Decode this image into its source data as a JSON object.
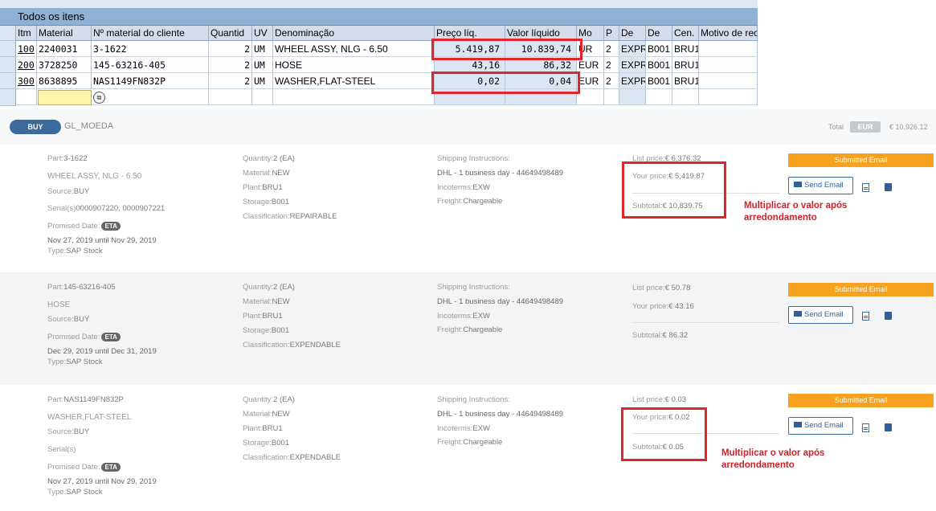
{
  "sap": {
    "title": "Todos os itens",
    "columns": [
      "Itm",
      "Material",
      "Nº material do cliente",
      "Quantid",
      "UV",
      "Denominação",
      "Preço líq.",
      "Valor líquido",
      "Mo",
      "P",
      "De",
      "De",
      "Cen.",
      "Motivo de rec"
    ],
    "rows": [
      {
        "itm": "100",
        "material": "2240031",
        "cust": "3-1622",
        "qty": "2",
        "uv": "UM",
        "desc": "WHEEL ASSY, NLG - 6.50",
        "price": "5.419,87",
        "value": "10.839,74",
        "mo": "UR",
        "p": "2",
        "de1": "EXPR",
        "de2": "B001",
        "cen": "BRU1"
      },
      {
        "itm": "200",
        "material": "3728250",
        "cust": "145-63216-405",
        "qty": "2",
        "uv": "UM",
        "desc": "HOSE",
        "price": "43,16",
        "value": "86,32",
        "mo": "EUR",
        "p": "2",
        "de1": "EXPR",
        "de2": "B001",
        "cen": "BRU1"
      },
      {
        "itm": "300",
        "material": "8638895",
        "cust": "NAS1149FN832P",
        "qty": "2",
        "uv": "UM",
        "desc": "WASHER,FLAT-STEEL",
        "price": "0,02",
        "value": "0,04",
        "mo": "EUR",
        "p": "2",
        "de1": "EXPR",
        "de2": "B001",
        "cen": "BRU1"
      }
    ],
    "highlight_color": "#e0262c"
  },
  "header": {
    "buy_label": "BUY",
    "currency_field": "GL_MOEDA",
    "total_label": "Total",
    "currency": "EUR",
    "total_value": "€ 10,926.12"
  },
  "items": [
    {
      "part_label": "Part:",
      "part": "3-1622",
      "name": "WHEEL ASSY, NLG - 6.50",
      "source_label": "Source:",
      "source": "BUY",
      "serials_label": "Serial(s)",
      "serials": "0000907220, 0000907221",
      "promised_label": "Promised Date:",
      "eta": "ETA",
      "dates": "Nov 27, 2019 until Nov 29, 2019",
      "type_label": "Type:",
      "type": "SAP Stock",
      "qty_label": "Quantity:",
      "qty": "2 (EA)",
      "material_label": "Material:",
      "material": "NEW",
      "plant_label": "Plant:",
      "plant": "BRU1",
      "storage_label": "Storage:",
      "storage": "B001",
      "class_label": "Classification:",
      "classification": "REPAIRABLE",
      "ship_label": "Shipping Instructions:",
      "ship": "DHL - 1 business day - 44649498489",
      "inco_label": "Incoterms:",
      "inco": "EXW",
      "freight_label": "Freight:",
      "freight": "Chargeable",
      "list_label": "List price:",
      "list": "€ 6,376.32",
      "your_label": "Your price:",
      "your": "€ 5,419.87",
      "sub_label": "Subtotal:",
      "subtotal": "€ 10,839.75",
      "status": "Submitted Email",
      "send": "Send Email",
      "annotation": "Multiplicar o valor após arredondamento"
    },
    {
      "part_label": "Part:",
      "part": "145-63216-405",
      "name": "HOSE",
      "source_label": "Source:",
      "source": "BUY",
      "promised_label": "Promised Date:",
      "eta": "ETA",
      "dates": "Dec 29, 2019 until Dec 31, 2019",
      "type_label": "Type:",
      "type": "SAP Stock",
      "qty_label": "Quantity:",
      "qty": "2 (EA)",
      "material_label": "Material:",
      "material": "NEW",
      "plant_label": "Plant:",
      "plant": "BRU1",
      "storage_label": "Storage:",
      "storage": "B001",
      "class_label": "Classification:",
      "classification": "EXPENDABLE",
      "ship_label": "Shipping Instructions:",
      "ship": "DHL - 1 business day - 44649498489",
      "inco_label": "Incoterms:",
      "inco": "EXW",
      "freight_label": "Freight:",
      "freight": "Chargeable",
      "list_label": "List price:",
      "list": "€ 50.78",
      "your_label": "Your price:",
      "your": "€ 43.16",
      "sub_label": "Subtotal:",
      "subtotal": "€ 86.32",
      "status": "Submitted Email",
      "send": "Send Email"
    },
    {
      "part_label": "Part:",
      "part": "NAS1149FN832P",
      "name": "WASHER,FLAT-STEEL",
      "source_label": "Source:",
      "source": "BUY",
      "serials_label": "Serial(s)",
      "promised_label": "Promised Date:",
      "eta": "ETA",
      "dates": "Nov 27, 2019 until Nov 29, 2019",
      "type_label": "Type:",
      "type": "SAP Stock",
      "qty_label": "Quantity:",
      "qty": "2 (EA)",
      "material_label": "Material:",
      "material": "NEW",
      "plant_label": "Plant:",
      "plant": "BRU1",
      "storage_label": "Storage:",
      "storage": "B001",
      "class_label": "Classification:",
      "classification": "EXPENDABLE",
      "ship_label": "Shipping Instructions:",
      "ship": "DHL - 1 business day - 44649498489",
      "inco_label": "Incoterms:",
      "inco": "EXW",
      "freight_label": "Freight:",
      "freight": "Chargeable",
      "list_label": "List price:",
      "list": "€ 0.03",
      "your_label": "Your price:",
      "your": "€ 0.02",
      "sub_label": "Subtotal:",
      "subtotal": "€ 0.05",
      "status": "Submitted Email",
      "send": "Send Email",
      "annotation": "Multiplicar o valor após arredondamento"
    }
  ]
}
